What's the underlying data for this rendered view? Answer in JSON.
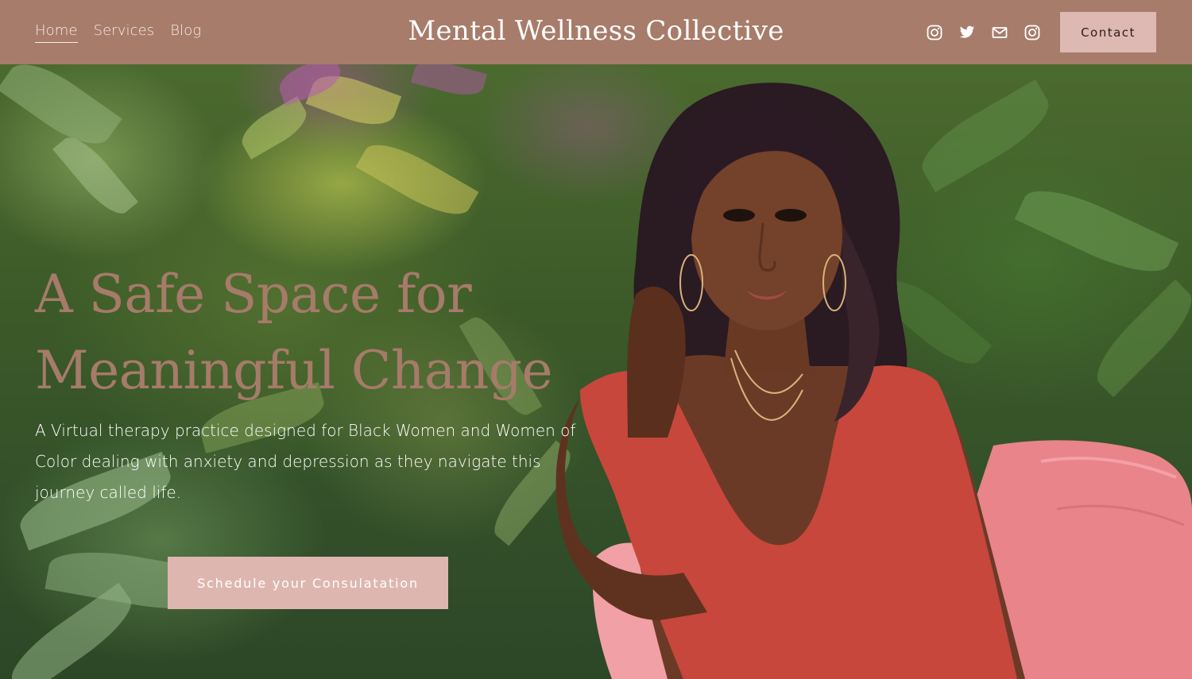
{
  "header": {
    "nav": [
      {
        "label": "Home",
        "active": true
      },
      {
        "label": "Services",
        "active": false
      },
      {
        "label": "Blog",
        "active": false
      }
    ],
    "site_title": "Mental Wellness Collective",
    "social_icons": [
      "instagram-icon",
      "twitter-icon",
      "mail-icon",
      "instagram-icon"
    ],
    "contact_label": "Contact"
  },
  "hero": {
    "heading_line1": "A Safe Space for",
    "heading_line2": "Meaningful Change",
    "subtitle": "A Virtual therapy practice designed for Black Women and Women of Color dealing with anxiety and depression as they navigate this journey called life.",
    "cta_label": "Schedule your Consulatation",
    "image": "portrait-photo"
  },
  "colors": {
    "header_bg": "#a77c6b",
    "heading": "#a67b6a",
    "button_bg": "#deb6b0",
    "contact_bg": "#deb8b3",
    "foliage": "#3c5a28",
    "dress": "#c7473c",
    "chair": "#e9848a"
  }
}
